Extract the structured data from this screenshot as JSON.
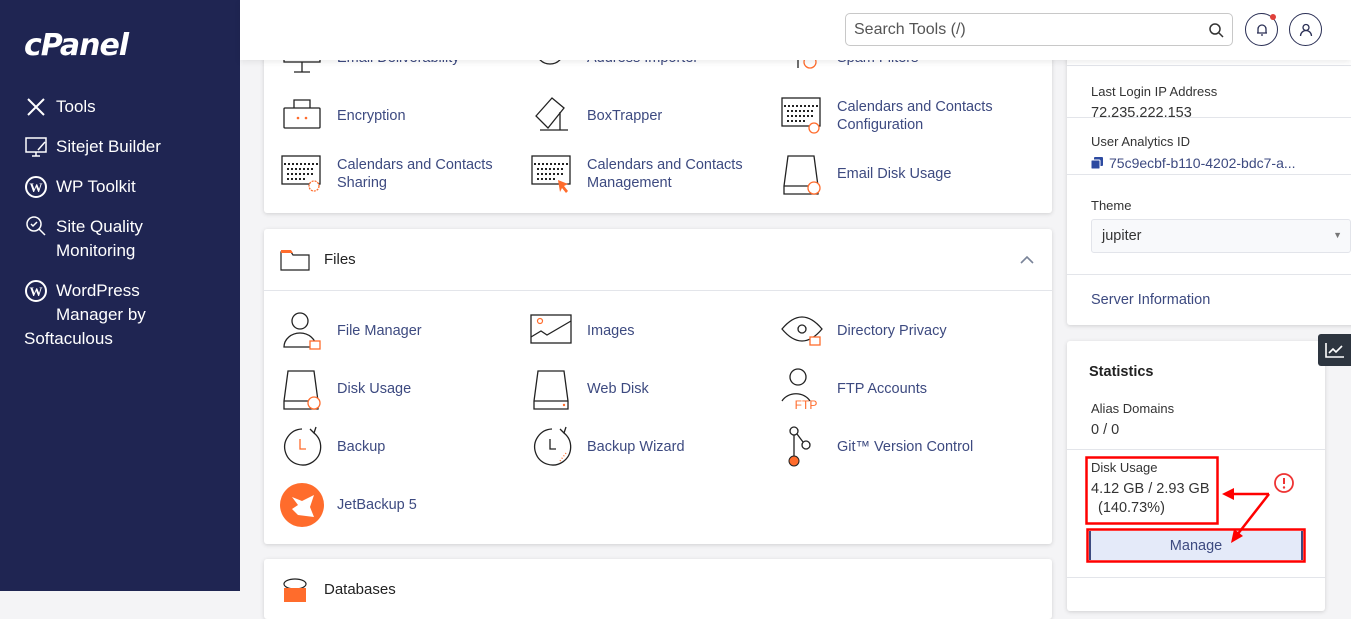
{
  "brand": "cPanel",
  "sidebar": {
    "items": [
      {
        "label": "Tools",
        "icon": "tools-icon"
      },
      {
        "label": "Sitejet Builder",
        "icon": "monitor-pen-icon"
      },
      {
        "label": "WP Toolkit",
        "icon": "wordpress-icon"
      },
      {
        "label": "Site Quality\nMonitoring",
        "icon": "magnifier-check-icon"
      },
      {
        "label": "WordPress\nManager by",
        "label2": "Softaculous",
        "icon": "wordpress-icon"
      }
    ]
  },
  "header": {
    "search_placeholder": "Search Tools (/)"
  },
  "email_section": {
    "items": [
      {
        "label": "Email Deliverability",
        "icon": "monitor-icon"
      },
      {
        "label": "Address Importer",
        "icon": "at-upload-icon"
      },
      {
        "label": "Spam Filters",
        "icon": "filter-alert-icon"
      },
      {
        "label": "Encryption",
        "icon": "lock-icon"
      },
      {
        "label": "BoxTrapper",
        "icon": "box-trap-icon"
      },
      {
        "label": "Calendars and Contacts\nConfiguration",
        "icon": "calendar-at-icon"
      },
      {
        "label": "Calendars and Contacts\nSharing",
        "icon": "calendar-gear-icon"
      },
      {
        "label": "Calendars and Contacts\nManagement",
        "icon": "calendar-cursor-icon"
      },
      {
        "label": "Email Disk Usage",
        "icon": "disk-pie-icon"
      }
    ]
  },
  "files_section": {
    "title": "Files",
    "items": [
      {
        "label": "File Manager",
        "icon": "user-folder-icon"
      },
      {
        "label": "Images",
        "icon": "image-icon"
      },
      {
        "label": "Directory Privacy",
        "icon": "eye-folder-icon"
      },
      {
        "label": "Disk Usage",
        "icon": "disk-pie-icon"
      },
      {
        "label": "Web Disk",
        "icon": "disk-icon"
      },
      {
        "label": "FTP Accounts",
        "icon": "user-ftp-icon"
      },
      {
        "label": "Backup",
        "icon": "clock-arrow-icon"
      },
      {
        "label": "Backup Wizard",
        "icon": "clock-wand-icon"
      },
      {
        "label": "Git™ Version Control",
        "icon": "git-icon"
      },
      {
        "label": "JetBackup 5",
        "icon": "jetbackup-icon"
      }
    ]
  },
  "databases_section": {
    "title": "Databases"
  },
  "general_info": {
    "last_login_label": "Last Login IP Address",
    "last_login_value": "72.235.222.153",
    "analytics_label": "User Analytics ID",
    "analytics_value": "75c9ecbf-b110-4202-bdc7-a...",
    "theme_label": "Theme",
    "theme_value": "jupiter",
    "server_info": "Server Information"
  },
  "statistics": {
    "title": "Statistics",
    "alias_label": "Alias Domains",
    "alias_value": "0 / 0",
    "disk_label": "Disk Usage",
    "disk_value": "4.12 GB / 2.93 GB",
    "disk_percent": "(140.73%)",
    "manage_label": "Manage"
  },
  "colors": {
    "sidebar": "#1f2552",
    "accent": "#ff6c2c",
    "annotation": "#ff0000",
    "label": "#3d4a80"
  }
}
